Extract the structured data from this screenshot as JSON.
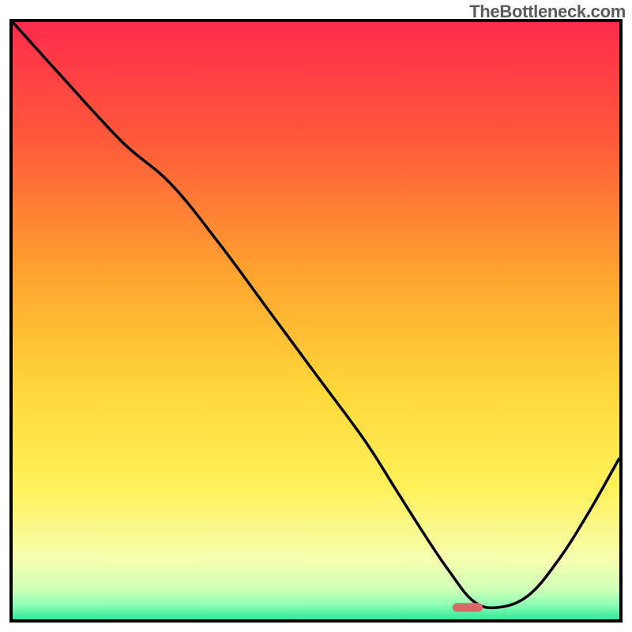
{
  "watermark": "TheBottleneck.com",
  "chart_data": {
    "type": "line",
    "title": "",
    "xlabel": "",
    "ylabel": "",
    "xlim": [
      0,
      100
    ],
    "ylim": [
      0,
      100
    ],
    "grid": false,
    "legend": false,
    "gradient_stops": [
      {
        "offset": 0,
        "color": "#ff2b4c"
      },
      {
        "offset": 0.2,
        "color": "#ff5a3a"
      },
      {
        "offset": 0.42,
        "color": "#ffa32f"
      },
      {
        "offset": 0.62,
        "color": "#ffd83a"
      },
      {
        "offset": 0.78,
        "color": "#fff15a"
      },
      {
        "offset": 0.9,
        "color": "#f6ffb0"
      },
      {
        "offset": 0.95,
        "color": "#cfffb8"
      },
      {
        "offset": 0.975,
        "color": "#8fffb5"
      },
      {
        "offset": 1.0,
        "color": "#2fe89a"
      }
    ],
    "series": [
      {
        "name": "bottleneck-curve",
        "x": [
          0,
          8,
          18,
          26,
          34,
          42,
          50,
          58,
          63,
          68,
          72,
          76,
          80,
          85,
          90,
          95,
          100
        ],
        "y": [
          100,
          91,
          80,
          73,
          63,
          52,
          41,
          30,
          22,
          14,
          8,
          3,
          2,
          4,
          10,
          18,
          27
        ]
      }
    ],
    "marker": {
      "x": 75,
      "y": 2,
      "width": 5,
      "height": 1.5,
      "color": "#d96a6a"
    }
  }
}
